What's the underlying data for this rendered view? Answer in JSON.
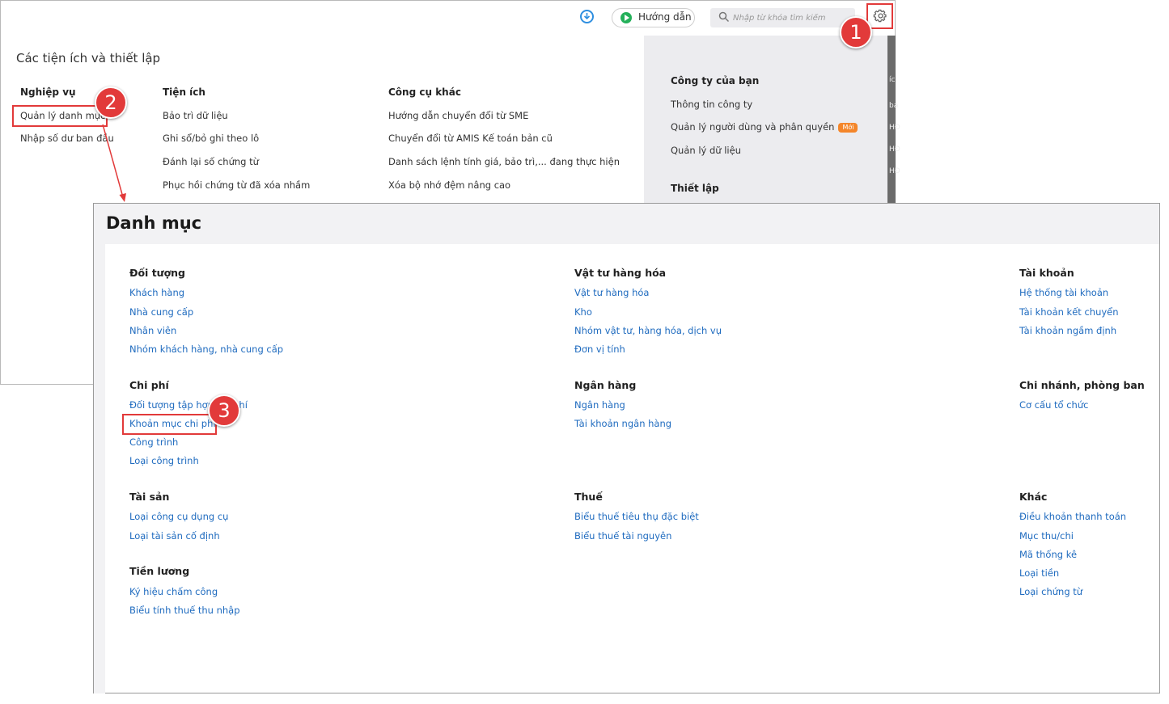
{
  "toolbar": {
    "guide_label": "Hướng dẫn",
    "search_placeholder": "Nhập từ khóa tìm kiếm"
  },
  "settings": {
    "title": "Các tiện ích và thiết lập",
    "columns": [
      {
        "heading": "Nghiệp vụ",
        "items": [
          "Quản lý danh mục",
          "Nhập số dư ban đầu"
        ]
      },
      {
        "heading": "Tiện ích",
        "items": [
          "Bảo trì dữ liệu",
          "Ghi sổ/bỏ ghi theo lô",
          "Đánh lại số chứng từ",
          "Phục hồi chứng từ đã xóa nhầm"
        ]
      },
      {
        "heading": "Công cụ khác",
        "items": [
          "Hướng dẫn chuyển đổi từ SME",
          "Chuyển đổi từ AMIS Kế toán bản cũ",
          "Danh sách lệnh tính giá, bảo trì,... đang thực hiện",
          "Xóa bộ nhớ đệm nâng cao"
        ]
      }
    ],
    "company": {
      "heading": "Công ty của bạn",
      "items": [
        "Thông tin công ty",
        "Quản lý người dùng và phân quyền",
        "Quản lý dữ liệu"
      ],
      "new_badge": "Mới",
      "setup_heading": "Thiết lập"
    },
    "strip_fragments": [
      "íc",
      "ba",
      "HĐ",
      "HĐ",
      "HĐ"
    ]
  },
  "markers": [
    "1",
    "2",
    "3"
  ],
  "catalog": {
    "title": "Danh mục",
    "groups": [
      {
        "heading": "Đối tượng",
        "items": [
          "Khách hàng",
          "Nhà cung cấp",
          "Nhân viên",
          "Nhóm khách hàng, nhà cung cấp"
        ]
      },
      {
        "heading": "Vật tư hàng hóa",
        "items": [
          "Vật tư hàng hóa",
          "Kho",
          "Nhóm vật tư, hàng hóa, dịch vụ",
          "Đơn vị tính"
        ]
      },
      {
        "heading": "Tài khoản",
        "items": [
          "Hệ thống tài khoản",
          "Tài khoản kết chuyển",
          "Tài khoản ngầm định"
        ]
      },
      {
        "heading": "Chi phí",
        "items": [
          "Đối tượng tập hợp chi phí",
          "Khoản mục chi phí",
          "Công trình",
          "Loại công trình"
        ]
      },
      {
        "heading": "Ngân hàng",
        "items": [
          "Ngân hàng",
          "Tài khoản ngân hàng"
        ]
      },
      {
        "heading": "Chi nhánh, phòng ban",
        "items": [
          "Cơ cấu tổ chức"
        ]
      },
      {
        "heading": "Tài sản",
        "items": [
          "Loại công cụ dụng cụ",
          "Loại tài sản cố định"
        ]
      },
      {
        "heading": "Thuế",
        "items": [
          "Biểu thuế tiêu thụ đặc biệt",
          "Biểu thuế tài nguyên"
        ]
      },
      {
        "heading": "Khác",
        "items": [
          "Điều khoản thanh toán",
          "Mục thu/chi",
          "Mã thống kê",
          "Loại tiền",
          "Loại chứng từ"
        ]
      },
      {
        "heading": "Tiền lương",
        "items": [
          "Ký hiệu chấm công",
          "Biểu tính thuế thu nhập"
        ]
      }
    ]
  },
  "colors": {
    "accent_red": "#e23a3a",
    "link_blue": "#1f6bbf",
    "badge_orange": "#f4862a",
    "play_green": "#24b05a"
  }
}
